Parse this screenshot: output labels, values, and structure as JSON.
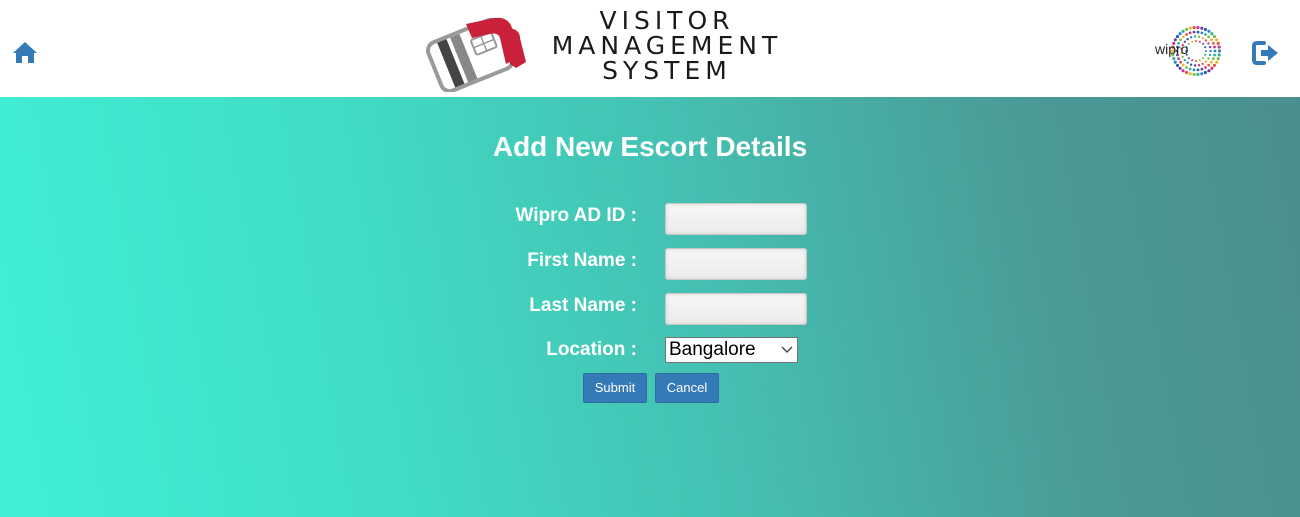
{
  "header": {
    "logo_line1": "VISITOR",
    "logo_line2": "MANAGEMENT",
    "logo_line3": "SYSTEM",
    "company_logo_text": "wipro",
    "home_icon": "home-icon",
    "logout_icon": "logout-icon"
  },
  "form": {
    "title": "Add New Escort Details",
    "ad_id_label": "Wipro AD ID :",
    "ad_id_value": "",
    "first_name_label": "First Name :",
    "first_name_value": "",
    "last_name_label": "Last Name :",
    "last_name_value": "",
    "location_label": "Location :",
    "location_selected": "Bangalore",
    "submit_label": "Submit",
    "cancel_label": "Cancel"
  },
  "colors": {
    "accent_blue": "#337ab7",
    "bg_gradient_start": "#40f0d6",
    "bg_gradient_end": "#4a8f8e",
    "logo_red": "#c9213a"
  }
}
